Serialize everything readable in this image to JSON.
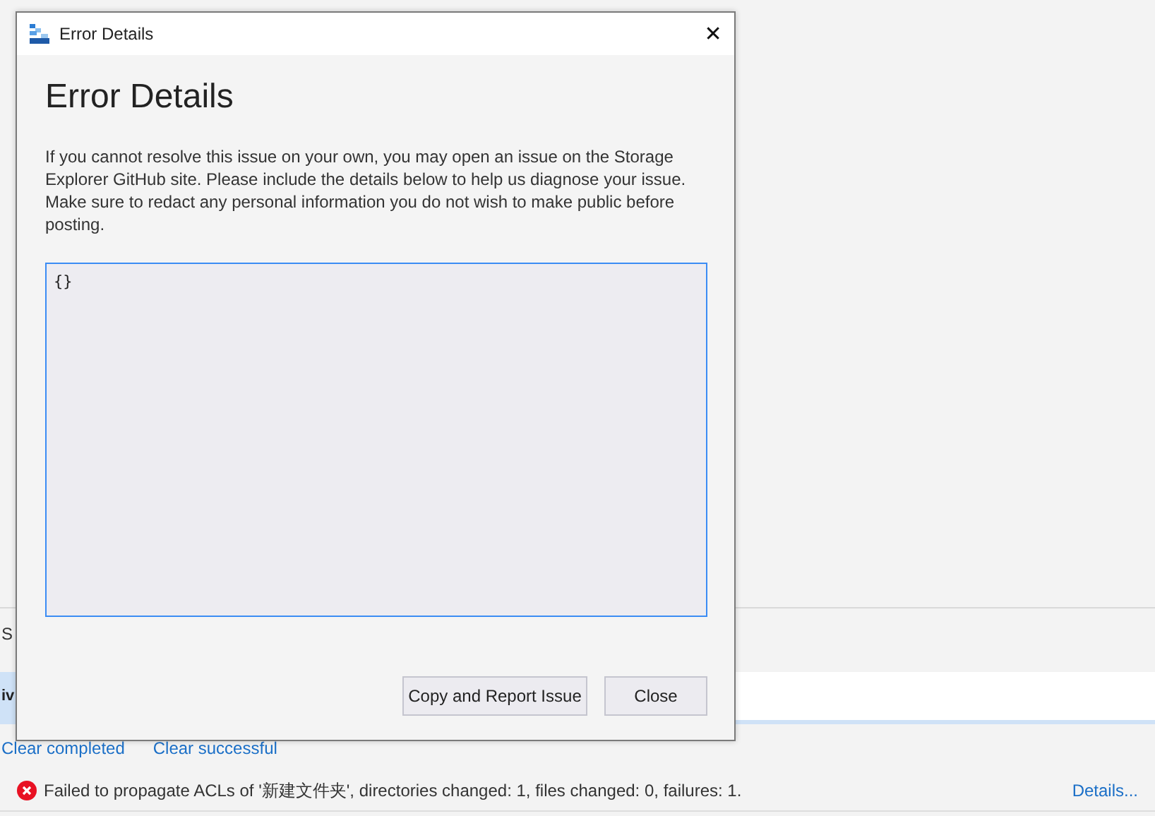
{
  "background": {
    "section_label": "S",
    "activity": {
      "label": "iv",
      "level": 1
    },
    "links": [
      "Clear completed",
      "Clear successful"
    ],
    "message": {
      "failed": true,
      "text": "Failed to propagate ACLs of '新建文件夹', directories changed: 1, files changed: 0, failures: 1.",
      "details_link": "Details..."
    }
  },
  "dialog": {
    "title": "Error Details",
    "close_glyph": "✕",
    "heading": "Error Details",
    "description": "If you cannot resolve this issue on your own, you may open an issue on the Storage Explorer GitHub site. Please include the details below to help us diagnose your issue. Make sure to redact any personal information you do not wish to make public before posting.",
    "details_value": "{}",
    "buttons": [
      "Copy and Report Issue",
      "Close"
    ]
  }
}
